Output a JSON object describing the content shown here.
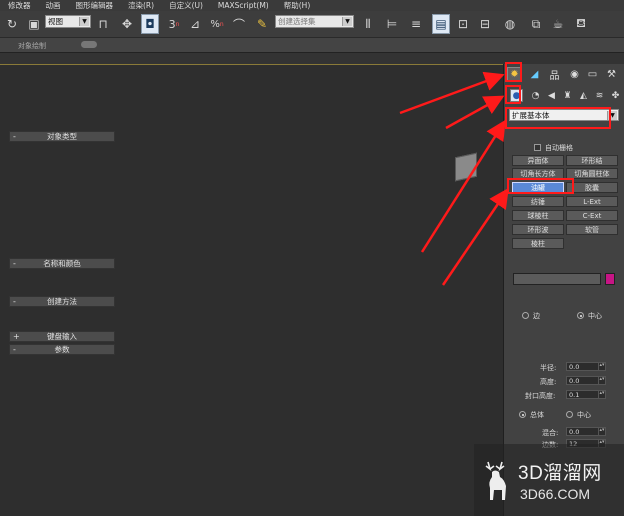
{
  "menu": [
    "修改器",
    "动画",
    "图形编辑器",
    "渲染(R)",
    "自定义(U)",
    "MAXScript(M)",
    "帮助(H)"
  ],
  "toolbar": {
    "view_dropdown": "视图",
    "selection_set_placeholder": "创建选择集",
    "snap_label": "3",
    "percent_snap_label": "%"
  },
  "ribbon": {
    "label": "对象绘制"
  },
  "panel": {
    "category_dropdown": "扩展基本体",
    "object_type": {
      "title": "对象类型",
      "autogrid": "自动栅格",
      "buttons": [
        "异面体",
        "环形结",
        "切角长方体",
        "切角圆柱体",
        "油罐",
        "胶囊",
        "纺锤",
        "L-Ext",
        "球棱柱",
        "C-Ext",
        "环形波",
        "软管",
        "棱柱"
      ],
      "selected": "油罐"
    },
    "name_color": {
      "title": "名称和颜色",
      "swatch_color": "#c71585"
    },
    "creation_method": {
      "title": "创建方法",
      "options": [
        "边",
        "中心"
      ],
      "selected": "中心"
    },
    "keyboard_entry": {
      "title": "键盘输入"
    },
    "parameters": {
      "title": "参数",
      "fields": [
        {
          "label": "半径:",
          "value": "0.0"
        },
        {
          "label": "高度:",
          "value": "0.0"
        },
        {
          "label": "封口高度:",
          "value": "0.1"
        }
      ],
      "radios": [
        "总体",
        "中心"
      ],
      "radio_selected": "总体",
      "fields2": [
        {
          "label": "混合:",
          "value": "0.0"
        },
        {
          "label": "边数:",
          "value": "12"
        }
      ]
    }
  },
  "watermark": {
    "title": "3D溜溜网",
    "url": "3D66.COM"
  },
  "colors": {
    "annotation_red": "#ff1a1a",
    "selected_blue": "#5a88d6"
  }
}
